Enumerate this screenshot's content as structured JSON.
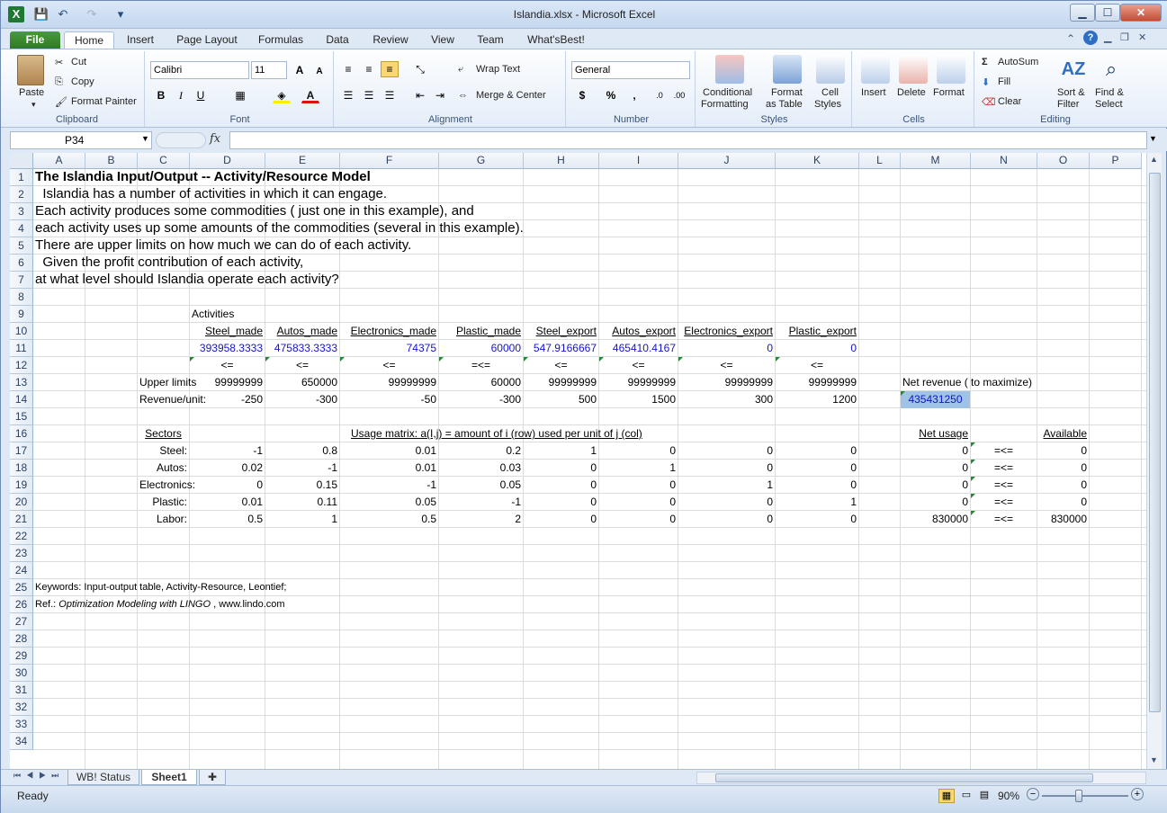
{
  "window": {
    "title": "Islandia.xlsx  -  Microsoft Excel",
    "minimize": "▁",
    "maximize": "☐",
    "close": "✕"
  },
  "quick_access": {
    "app_icon": "X",
    "save_icon": "💾",
    "undo_icon": "↶",
    "redo_icon": "↷",
    "customize_icon": "▾"
  },
  "tabs": [
    "File",
    "Home",
    "Insert",
    "Page Layout",
    "Formulas",
    "Data",
    "Review",
    "View",
    "Team",
    "What'sBest!"
  ],
  "ribbon": {
    "clipboard": {
      "label": "Clipboard",
      "paste": "Paste",
      "cut": "Cut",
      "copy": "Copy",
      "format_painter": "Format Painter"
    },
    "font": {
      "label": "Font",
      "font_name": "Calibri",
      "font_size": "11",
      "bold": "B",
      "italic": "I",
      "underline": "U"
    },
    "alignment": {
      "label": "Alignment",
      "wrap_text": "Wrap Text",
      "merge_center": "Merge & Center"
    },
    "number": {
      "label": "Number",
      "format": "General",
      "currency": "$",
      "percent": "%",
      "comma": ","
    },
    "styles": {
      "label": "Styles",
      "conditional": "Conditional",
      "conditional2": "Formatting",
      "format_table": "Format",
      "format_table2": "as Table",
      "cell_styles": "Cell",
      "cell_styles2": "Styles"
    },
    "cells": {
      "label": "Cells",
      "insert": "Insert",
      "delete": "Delete",
      "format": "Format"
    },
    "editing": {
      "label": "Editing",
      "autosum": "AutoSum",
      "fill": "Fill",
      "clear": "Clear",
      "sort": "Sort &",
      "sort2": "Filter",
      "find": "Find &",
      "find2": "Select"
    }
  },
  "formula_bar": {
    "name_box": "P34",
    "fx": "fx",
    "formula": ""
  },
  "columns": [
    "A",
    "B",
    "C",
    "D",
    "E",
    "F",
    "G",
    "H",
    "I",
    "J",
    "K",
    "L",
    "M",
    "N",
    "O",
    "P"
  ],
  "rows": [
    "1",
    "2",
    "3",
    "4",
    "5",
    "6",
    "7",
    "8",
    "9",
    "10",
    "11",
    "12",
    "13",
    "14",
    "15",
    "16",
    "17",
    "18",
    "19",
    "20",
    "21",
    "22",
    "23",
    "24",
    "25",
    "26",
    "27",
    "28",
    "29",
    "30",
    "31",
    "32",
    "33",
    "34"
  ],
  "sheet": {
    "title": "The Islandia Input/Output  -- Activity/Resource Model",
    "intro": [
      "  Islandia has a number of activities in which it can engage.",
      "Each activity produces some commodities ( just one in this example), and",
      "each activity uses up some amounts of the commodities (several in this example).",
      "There are upper limits on how much we can do of each activity.",
      "  Given the profit contribution of each activity,",
      "at what level should Islandia operate each activity?"
    ],
    "activities_label": "Activities",
    "activities": [
      "Steel_made",
      "Autos_made",
      "Electronics_made",
      "Plastic_made",
      "Steel_export",
      "Autos_export",
      "Electronics_export",
      "Plastic_export"
    ],
    "levels": [
      "393958.3333",
      "475833.3333",
      "74375",
      "60000",
      "547.9166667",
      "465410.4167",
      "0",
      "0"
    ],
    "ops": [
      "<=",
      "<=",
      "<=",
      "=<=",
      "<=",
      "<=",
      "<=",
      "<="
    ],
    "upper_label": "Upper limits",
    "upper": [
      "99999999",
      "650000",
      "99999999",
      "60000",
      "99999999",
      "99999999",
      "99999999",
      "99999999"
    ],
    "revenue_label": "Revenue/unit:",
    "revenue": [
      "-250",
      "-300",
      "-50",
      "-300",
      "500",
      "1500",
      "300",
      "1200"
    ],
    "net_revenue_label": "Net revenue ( to maximize)",
    "net_revenue": "435431250",
    "sectors_label": "Sectors",
    "usage_label": "Usage matrix: a(I,j) = amount of i (row) used per unit of j (col)",
    "net_usage_label": "Net usage",
    "available_label": "Available",
    "matrix": [
      {
        "name": "Steel:",
        "vals": [
          "-1",
          "0.8",
          "0.01",
          "0.2",
          "1",
          "0",
          "0",
          "0"
        ],
        "usage": "0",
        "op": "=<=",
        "avail": "0"
      },
      {
        "name": "Autos:",
        "vals": [
          "0.02",
          "-1",
          "0.01",
          "0.03",
          "0",
          "1",
          "0",
          "0"
        ],
        "usage": "0",
        "op": "=<=",
        "avail": "0"
      },
      {
        "name": "Electronics:",
        "vals": [
          "0",
          "0.15",
          "-1",
          "0.05",
          "0",
          "0",
          "1",
          "0"
        ],
        "usage": "0",
        "op": "=<=",
        "avail": "0"
      },
      {
        "name": "Plastic:",
        "vals": [
          "0.01",
          "0.11",
          "0.05",
          "-1",
          "0",
          "0",
          "0",
          "1"
        ],
        "usage": "0",
        "op": "=<=",
        "avail": "0"
      },
      {
        "name": "Labor:",
        "vals": [
          "0.5",
          "1",
          "0.5",
          "2",
          "0",
          "0",
          "0",
          "0"
        ],
        "usage": "830000",
        "op": "=<=",
        "avail": "830000"
      }
    ],
    "keywords": "Keywords:  Input-output table, Activity-Resource, Leontief;",
    "ref_prefix": "Ref.: ",
    "ref_title": "Optimization Modeling with LINGO",
    "ref_suffix": " , www.lindo.com"
  },
  "sheet_tabs": [
    "WB! Status",
    "Sheet1"
  ],
  "status": {
    "ready": "Ready",
    "zoom": "90%"
  }
}
